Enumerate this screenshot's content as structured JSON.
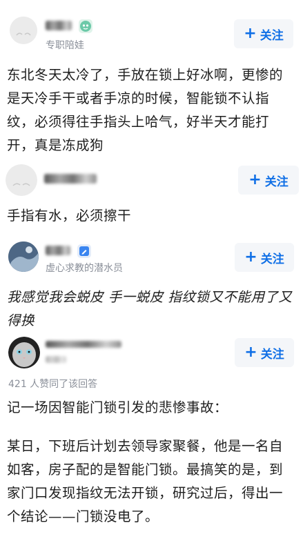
{
  "posts": [
    {
      "subtitle": "专职陪娃",
      "follow_label": "关注",
      "text": "东北冬天太冷了，手放在锁上好冰啊，更惨的是天冷手干或者手凉的时候，智能锁不认指纹，必须得往手指头上哈气，好半天才能打开，真是冻成狗"
    },
    {
      "subtitle": "",
      "follow_label": "关注",
      "text": "手指有水，必须擦干"
    },
    {
      "subtitle": "虚心求教的潜水员",
      "follow_label": "关注",
      "text": "我感觉我会蜕皮 手一蜕皮 指纹锁又不能用了又得换"
    },
    {
      "subtitle": "",
      "follow_label": "关注",
      "likes": "421 人赞同了该回答",
      "text_p1": "记一场因智能门锁引发的悲惨事故：",
      "text_p2": "某日，下班后计划去领导家聚餐，他是一名自如客，房子配的是智能门锁。最搞笑的是，到家门口发现指纹无法开锁，研究过后，得出一个结论——门锁没电了。"
    }
  ],
  "icons": {
    "follow": "plus-icon",
    "badge1": "mascot-badge-icon",
    "badge3": "pencil-badge-icon"
  },
  "colors": {
    "accent": "#0f6fe6",
    "button_bg": "#f4f6f9",
    "subtle_text": "#8a8f99"
  }
}
